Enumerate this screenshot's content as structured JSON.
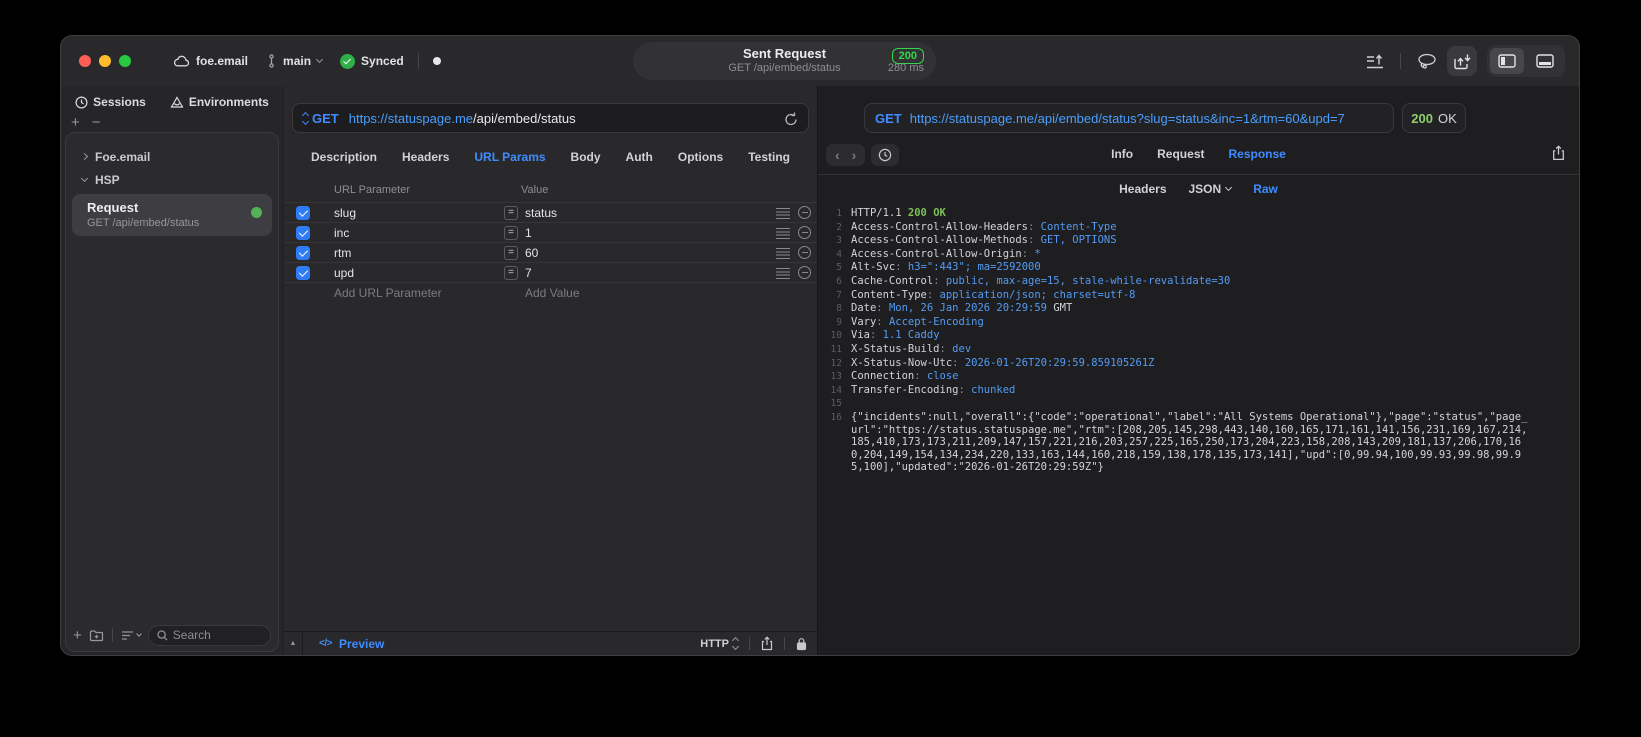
{
  "icons": {
    "plus": "+",
    "minus": "−",
    "back": "‹",
    "forward": "›",
    "equals": "=",
    "expand": "▲",
    "code": "</>"
  },
  "titlebar": {
    "project": "foe.email",
    "branch": "main",
    "sync_status": "Synced",
    "center": {
      "title": "Sent Request",
      "subtitle": "GET /api/embed/status",
      "status_code": "200",
      "duration": "280 ms"
    }
  },
  "sidebar": {
    "tabs": [
      "Sessions",
      "Environments"
    ],
    "tree": [
      "Foe.email",
      "HSP"
    ],
    "request_item": {
      "title": "Request",
      "subtitle": "GET /api/embed/status"
    },
    "search_placeholder": "Search"
  },
  "request": {
    "method": "GET",
    "url_host": "https://statuspage.me",
    "url_path": "/api/embed/status",
    "tabs": [
      "Description",
      "Headers",
      "URL Params",
      "Body",
      "Auth",
      "Options",
      "Testing"
    ],
    "active_tab": "URL Params",
    "table": {
      "col1": "URL Parameter",
      "col2": "Value",
      "rows": [
        {
          "name": "slug",
          "value": "status"
        },
        {
          "name": "inc",
          "value": "1"
        },
        {
          "name": "rtm",
          "value": "60"
        },
        {
          "name": "upd",
          "value": "7"
        }
      ],
      "add_name": "Add URL Parameter",
      "add_value": "Add Value"
    },
    "footer": {
      "preview": "Preview",
      "protocol": "HTTP"
    }
  },
  "response": {
    "method": "GET",
    "url": "https://statuspage.me/api/embed/status?slug=status&inc=1&rtm=60&upd=7",
    "status_code": "200",
    "status_text": "OK",
    "tabs": [
      "Info",
      "Request",
      "Response"
    ],
    "active_tab": "Response",
    "subtabs": [
      "Headers",
      "JSON",
      "Raw"
    ],
    "active_subtab": "Raw",
    "colon": ": ",
    "lines": {
      "l1": {
        "no": "1",
        "protocol": "HTTP/1.1 ",
        "status": "200 OK"
      },
      "headers": [
        {
          "no": "2",
          "name": "Access-Control-Allow-Headers",
          "value": "Content-Type"
        },
        {
          "no": "3",
          "name": "Access-Control-Allow-Methods",
          "value": "GET, OPTIONS"
        },
        {
          "no": "4",
          "name": "Access-Control-Allow-Origin",
          "value": "*"
        },
        {
          "no": "5",
          "name": "Alt-Svc",
          "value": "h3=\":443\"; ma=2592000"
        },
        {
          "no": "6",
          "name": "Cache-Control",
          "value": "public, max-age=15, stale-while-revalidate=30"
        },
        {
          "no": "7",
          "name": "Content-Type",
          "value": "application/json; charset=utf-8"
        },
        {
          "no": "8",
          "name": "Date",
          "value": "Mon, 26 Jan 2026 20:29:59",
          "suffix": " GMT"
        },
        {
          "no": "9",
          "name": "Vary",
          "value": "Accept-Encoding"
        },
        {
          "no": "10",
          "name": "Via",
          "value": "1.1 Caddy"
        },
        {
          "no": "11",
          "name": "X-Status-Build",
          "value": "dev"
        },
        {
          "no": "12",
          "name": "X-Status-Now-Utc",
          "value": "2026-01-26T20:29:59.859105261Z"
        },
        {
          "no": "13",
          "name": "Connection",
          "value": "close"
        },
        {
          "no": "14",
          "name": "Transfer-Encoding",
          "value": "chunked"
        }
      ],
      "l15": {
        "no": "15"
      },
      "l16": {
        "no": "16",
        "body": "{\"incidents\":null,\"overall\":{\"code\":\"operational\",\"label\":\"All Systems Operational\"},\"page\":\"status\",\"page_url\":\"https://status.statuspage.me\",\"rtm\":[208,205,145,298,443,140,160,165,171,161,141,156,231,169,167,214,185,410,173,173,211,209,147,157,221,216,203,257,225,165,250,173,204,223,158,208,143,209,181,137,206,170,160,204,149,154,134,234,220,133,163,144,160,218,159,138,178,135,173,141],\"upd\":[0,99.94,100,99.93,99.98,99.95,100],\"updated\":\"2026-01-26T20:29:59Z\"}"
      }
    }
  }
}
